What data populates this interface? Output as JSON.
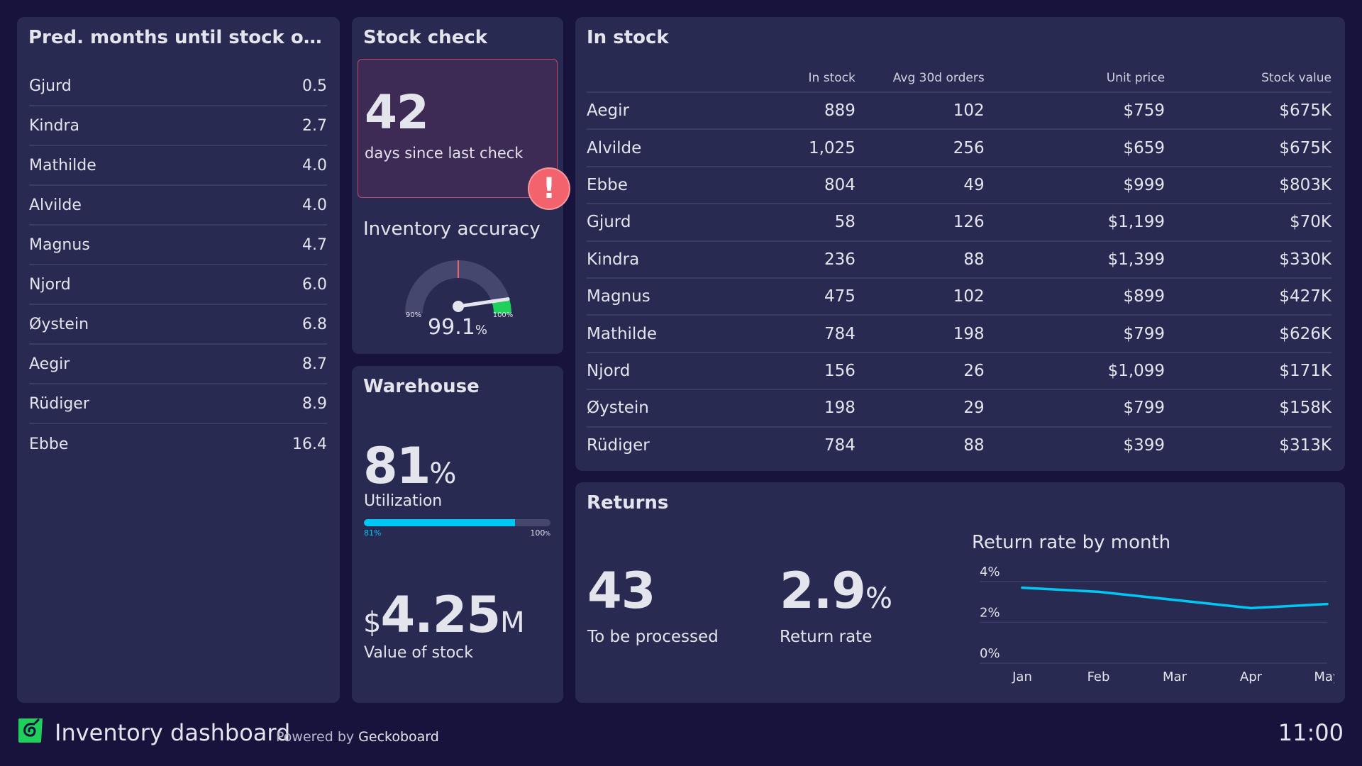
{
  "colors": {
    "background": "#17133d",
    "panel": "#282a52",
    "accent_cyan": "#00c8f5",
    "alert_red": "#f2636e",
    "good_green": "#1fd05a",
    "logo_green": "#1fd05a"
  },
  "outage": {
    "title": "Pred. months until stock outage",
    "title_display": "Pred. months until stock outag...",
    "items": [
      {
        "name": "Gjurd",
        "value": "0.5"
      },
      {
        "name": "Kindra",
        "value": "2.7"
      },
      {
        "name": "Mathilde",
        "value": "4.0"
      },
      {
        "name": "Alvilde",
        "value": "4.0"
      },
      {
        "name": "Magnus",
        "value": "4.7"
      },
      {
        "name": "Njord",
        "value": "6.0"
      },
      {
        "name": "Øystein",
        "value": "6.8"
      },
      {
        "name": "Aegir",
        "value": "8.7"
      },
      {
        "name": "Rüdiger",
        "value": "8.9"
      },
      {
        "name": "Ebbe",
        "value": "16.4"
      }
    ]
  },
  "stock_check": {
    "title": "Stock check",
    "days_value": "42",
    "days_label": "days since last check",
    "alert_icon": "exclamation-icon",
    "alert_glyph": "!",
    "accuracy": {
      "title": "Inventory accuracy",
      "value": "99.1",
      "unit": "%",
      "value_fraction": 0.91,
      "min_label": "90",
      "max_label": "100",
      "tick_unit": "%",
      "target_fraction": 0.5,
      "good_band_from_fraction": 0.9
    }
  },
  "warehouse": {
    "title": "Warehouse",
    "utilization_value": "81",
    "utilization_unit": "%",
    "utilization_label": "Utilization",
    "progress_percent": 81,
    "progress_min_label": "81%",
    "progress_max_label": "100",
    "progress_max_unit": "%",
    "stock_value_currency": "$",
    "stock_value": "4.25",
    "stock_value_unit": "M",
    "stock_value_label": "Value of stock"
  },
  "in_stock": {
    "title": "In stock",
    "columns": [
      "",
      "In stock",
      "Avg 30d orders",
      "Unit price",
      "Stock value"
    ],
    "rows": [
      [
        "Aegir",
        "889",
        "102",
        "$759",
        "$675K"
      ],
      [
        "Alvilde",
        "1,025",
        "256",
        "$659",
        "$675K"
      ],
      [
        "Ebbe",
        "804",
        "49",
        "$999",
        "$803K"
      ],
      [
        "Gjurd",
        "58",
        "126",
        "$1,199",
        "$70K"
      ],
      [
        "Kindra",
        "236",
        "88",
        "$1,399",
        "$330K"
      ],
      [
        "Magnus",
        "475",
        "102",
        "$899",
        "$427K"
      ],
      [
        "Mathilde",
        "784",
        "198",
        "$799",
        "$626K"
      ],
      [
        "Njord",
        "156",
        "26",
        "$1,099",
        "$171K"
      ],
      [
        "Øystein",
        "198",
        "29",
        "$799",
        "$158K"
      ],
      [
        "Rüdiger",
        "784",
        "88",
        "$399",
        "$313K"
      ]
    ]
  },
  "returns": {
    "title": "Returns",
    "to_process_value": "43",
    "to_process_label": "To be processed",
    "rate_value": "2.9",
    "rate_unit": "%",
    "rate_label": "Return rate"
  },
  "chart_data": {
    "type": "line",
    "title": "Return rate by month",
    "categories": [
      "Jan",
      "Feb",
      "Mar",
      "Apr",
      "May"
    ],
    "series": [
      {
        "name": "Return rate",
        "values": [
          3.7,
          3.5,
          3.1,
          2.7,
          2.9
        ],
        "color": "#00c8f5"
      }
    ],
    "ylim": [
      0,
      4
    ],
    "yticks": [
      0,
      2,
      4
    ],
    "ytick_labels": [
      "0%",
      "2%",
      "4%"
    ],
    "xlabel": "",
    "ylabel": "",
    "grid": true,
    "legend": "none"
  },
  "footer": {
    "title": "Inventory dashboard",
    "powered_prefix": "Powered by",
    "powered_brand": "Geckoboard",
    "clock": "11:00",
    "logo_icon": "geckoboard-logo-icon"
  }
}
